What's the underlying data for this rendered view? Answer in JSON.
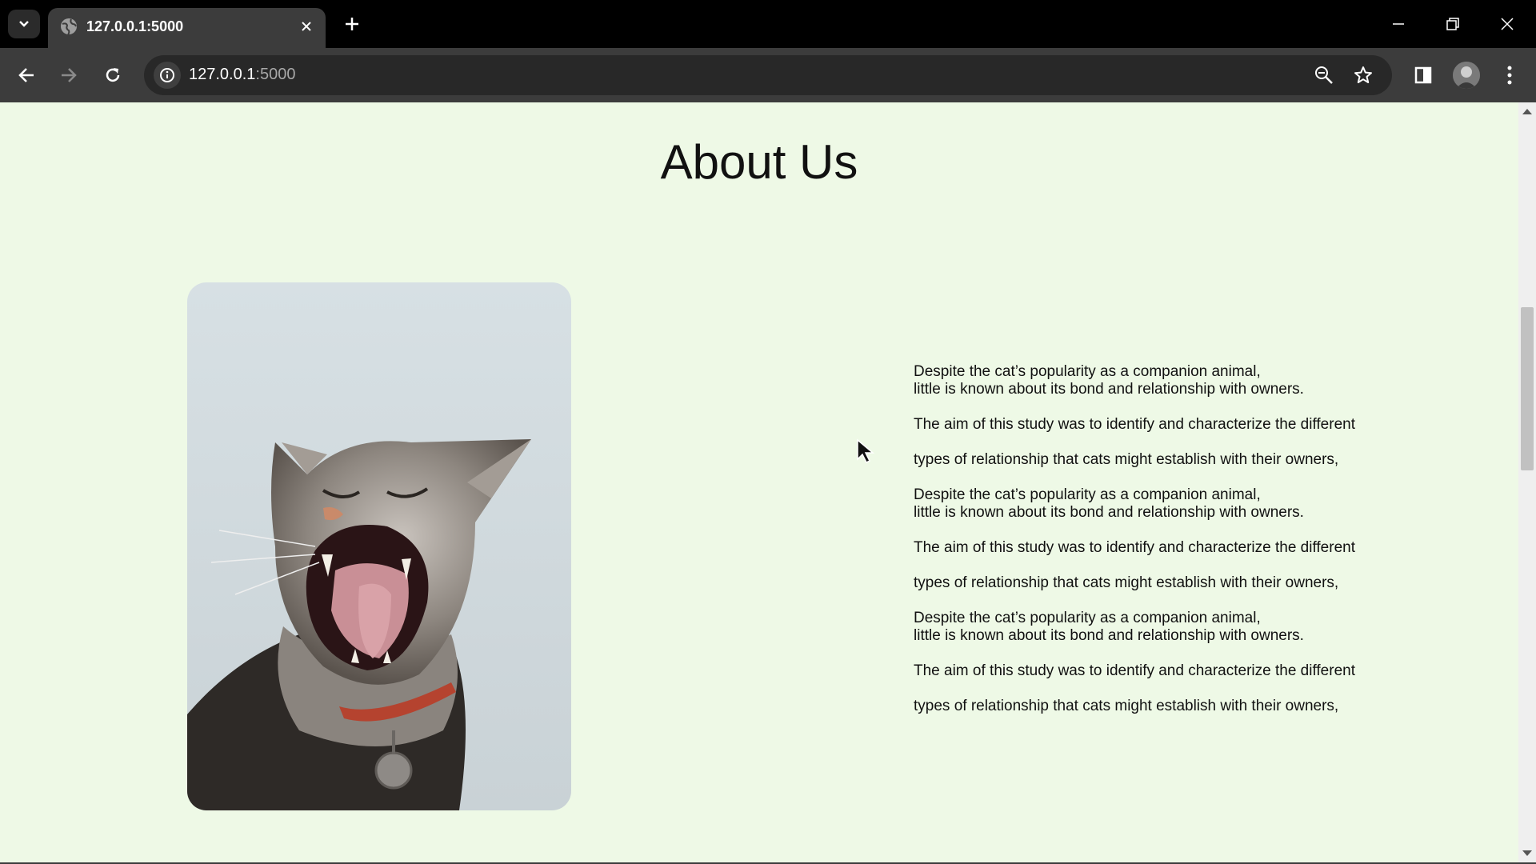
{
  "browser": {
    "tab": {
      "title": "127.0.0.1:5000"
    },
    "url": {
      "host": "127.0.0.1",
      "port": ":5000"
    },
    "icons": [
      "tab-search-icon",
      "globe-icon",
      "close-icon",
      "plus-icon",
      "minimize-icon",
      "restore-icon",
      "close-window-icon",
      "back-arrow-icon",
      "forward-arrow-icon",
      "reload-icon",
      "info-icon",
      "zoom-icon",
      "star-icon",
      "sidebar-icon",
      "avatar",
      "kebab-menu-icon"
    ]
  },
  "page": {
    "title": "About Us",
    "image_alt": "yawning cat",
    "paragraphs": [
      {
        "lines": [
          "Despite the cat’s popularity as a companion animal,",
          "little is known about its bond and relationship with owners."
        ]
      },
      {
        "lines": [
          "The aim of this study was to identify and characterize the different"
        ]
      },
      {
        "lines": [
          "types of relationship that cats might establish with their owners,"
        ]
      },
      {
        "lines": [
          "Despite the cat’s popularity as a companion animal,",
          "little is known about its bond and relationship with owners."
        ]
      },
      {
        "lines": [
          "The aim of this study was to identify and characterize the different"
        ]
      },
      {
        "lines": [
          "types of relationship that cats might establish with their owners,"
        ]
      },
      {
        "lines": [
          "Despite the cat’s popularity as a companion animal,",
          "little is known about its bond and relationship with owners."
        ]
      },
      {
        "lines": [
          "The aim of this study was to identify and characterize the different"
        ]
      },
      {
        "lines": [
          "types of relationship that cats might establish with their owners,"
        ]
      }
    ]
  },
  "colors": {
    "page_bg": "#eef9e6",
    "chrome_bg": "#3c3c3c",
    "tabstrip_bg": "#000000"
  }
}
